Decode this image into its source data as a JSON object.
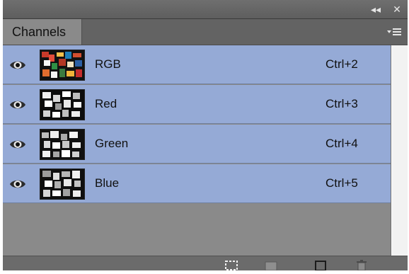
{
  "titlebar": {
    "collapse_icon": "double-chevron-left-icon",
    "close_icon": "close-icon",
    "collapse_glyph": "◂◂",
    "close_glyph": "✕"
  },
  "tabs": [
    {
      "label": "Channels",
      "active": true
    }
  ],
  "panel_menu_icon": "panel-menu-icon",
  "channels": [
    {
      "name": "RGB",
      "shortcut": "Ctrl+2",
      "visible": true,
      "thumb": "rgb-thumbnail"
    },
    {
      "name": "Red",
      "shortcut": "Ctrl+3",
      "visible": true,
      "thumb": "red-thumbnail"
    },
    {
      "name": "Green",
      "shortcut": "Ctrl+4",
      "visible": true,
      "thumb": "green-thumbnail"
    },
    {
      "name": "Blue",
      "shortcut": "Ctrl+5",
      "visible": true,
      "thumb": "blue-thumbnail"
    }
  ],
  "bottom_icons": [
    "load-selection-icon",
    "save-selection-icon",
    "new-channel-icon",
    "trash-icon"
  ],
  "colors": {
    "row_selected": "#95aad6",
    "panel_bg": "#8a8a8a",
    "titlebar": "#666666"
  }
}
